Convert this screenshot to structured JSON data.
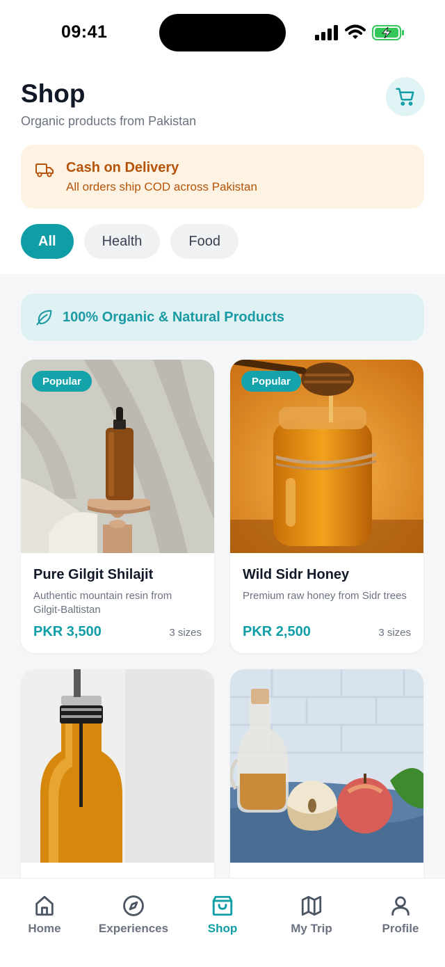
{
  "status_bar": {
    "time": "09:41"
  },
  "header": {
    "title": "Shop",
    "subtitle": "Organic products from Pakistan",
    "cart_icon": "cart-icon"
  },
  "cod_banner": {
    "icon": "truck-icon",
    "title": "Cash on Delivery",
    "text": "All orders ship COD across Pakistan"
  },
  "filters": [
    {
      "label": "All",
      "active": true
    },
    {
      "label": "Health",
      "active": false
    },
    {
      "label": "Food",
      "active": false
    }
  ],
  "organic_banner": {
    "icon": "leaf-icon",
    "text": "100% Organic & Natural Products"
  },
  "products": [
    {
      "badge": "Popular",
      "name": "Pure Gilgit Shilajit",
      "description": "Authentic mountain resin from Gilgit-Baltistan",
      "price": "PKR 3,500",
      "sizes": "3 sizes"
    },
    {
      "badge": "Popular",
      "name": "Wild Sidr Honey",
      "description": "Premium raw honey from Sidr trees",
      "price": "PKR 2,500",
      "sizes": "3 sizes"
    }
  ],
  "bottom_nav": [
    {
      "label": "Home",
      "icon": "home-icon",
      "active": false
    },
    {
      "label": "Experiences",
      "icon": "compass-icon",
      "active": false
    },
    {
      "label": "Shop",
      "icon": "shopping-bag-icon",
      "active": true
    },
    {
      "label": "My Trip",
      "icon": "map-icon",
      "active": false
    },
    {
      "label": "Profile",
      "icon": "user-icon",
      "active": false
    }
  ],
  "colors": {
    "accent": "#0f9ea6",
    "cod_text": "#b45309",
    "cod_bg": "#fef3e2",
    "organic_bg": "#dff1f3"
  }
}
